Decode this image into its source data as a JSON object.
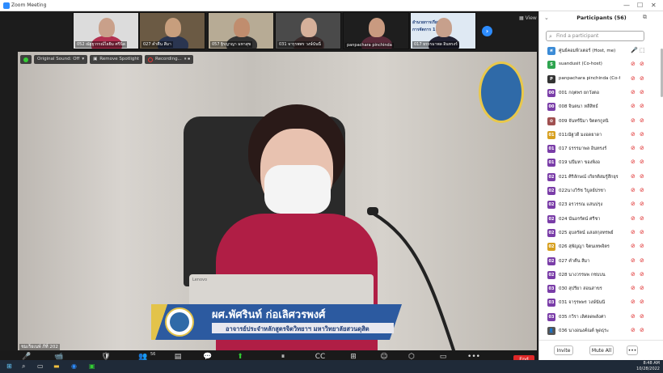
{
  "window": {
    "title": "Zoom Meeting",
    "controls": [
      "—",
      "☐",
      "✕"
    ]
  },
  "thumbnails": [
    {
      "name": "052 ณัฐฐวรรณ์ไธยิม ศรีนิล",
      "bg": "#dcdcdc",
      "skin": "#c9a08a",
      "cloth": "#b23050",
      "muted": true
    },
    {
      "name": "027 ค่ำคืน สีมา",
      "bg": "#6b5a44",
      "skin": "#c79e7d",
      "cloth": "#2a3550",
      "muted": true
    },
    {
      "name": "057 ฐิรญาญา มหาสุข",
      "bg": "#b7ab95",
      "skin": "#c08d6e",
      "cloth": "#333",
      "muted": true
    },
    {
      "name": "031 จารุรพพร วงษ์นันนี่",
      "bg": "#4a4a4a",
      "skin": "#d6b09a",
      "cloth": "#3a2a2a",
      "muted": true
    },
    {
      "name": "panpachara pinchinda",
      "bg": "#1e1e1e",
      "skin": "#c99a80",
      "cloth": "#5a2a3a",
      "muted": false
    },
    {
      "name": "017 ธรรรมาพล อินทรงร์",
      "bg": "#dfe9f3",
      "skin": "#c7a08c",
      "cloth": "#223",
      "muted": true,
      "slide_lines": [
        "อำนวยการเรียนรู้ร่วม",
        "การจัดการ 116"
      ]
    }
  ],
  "view_label": "View",
  "next_label": "›",
  "video": {
    "top_controls": [
      "Original Sound: Off",
      "Remove Spotlight",
      "Recording..."
    ],
    "speaker_name": "ผศ.พัศรินท์ ก่อเลิศวรพงศ์",
    "speaker_role": "อาจารย์ประจำหลักสูตรจิตวิทยาฯ มหาวิทยาลัยสวนดุสิต",
    "self_label": "ชมเร็ยเนพ์ ภีที่ 202",
    "laptop_brand": "Lenovo"
  },
  "toolbar": [
    {
      "label": "Mute",
      "icon": "🎤"
    },
    {
      "label": "Stop Video",
      "icon": "📹"
    },
    {
      "label": "Security",
      "icon": "🛡"
    },
    {
      "label": "Participants",
      "icon": "👥",
      "badge": "56"
    },
    {
      "label": "Polls",
      "icon": "▤"
    },
    {
      "label": "Chat",
      "icon": "💬"
    },
    {
      "label": "Share Screen",
      "icon": "⬆"
    },
    {
      "label": "Pause/Stop Recording",
      "icon": "⏸"
    },
    {
      "label": "Live Transcript",
      "icon": "CC"
    },
    {
      "label": "Breakout Rooms",
      "icon": "⊞"
    },
    {
      "label": "Reactions",
      "icon": "☺"
    },
    {
      "label": "Apps",
      "icon": "⬡"
    },
    {
      "label": "Whiteboards",
      "icon": "▭"
    },
    {
      "label": "More",
      "icon": "•••"
    }
  ],
  "end_label": "End",
  "participants": {
    "title": "Participants (56)",
    "search_placeholder": "Find a participant",
    "items": [
      {
        "initials": "ศ",
        "name": "ศูนย์คอมพิวเตอร์ (Host, me)",
        "color": "#3b8bd6",
        "mic": "🎤",
        "cam": "⬚"
      },
      {
        "initials": "S",
        "name": "suandusit (Co-host)",
        "color": "#2ea44f",
        "mic": "⊘",
        "cam": "⊘"
      },
      {
        "initials": "P",
        "name": "panpachara pinchinda (Co-host)",
        "color": "#333",
        "mic": "⊘",
        "cam": "⊘"
      },
      {
        "initials": "00",
        "name": "001 กฤตพร ยกวังตอ",
        "color": "#7a3da8",
        "mic": "⊘",
        "cam": "⊘"
      },
      {
        "initials": "00",
        "name": "008 จินตนา หลีสิทธ์",
        "color": "#7a3da8",
        "mic": "⊘",
        "cam": "⊘"
      },
      {
        "initials": "✿",
        "name": "009 จันทร์ปิมา จิตตรกูลนิ",
        "color": "#a05050",
        "mic": "⊘",
        "cam": "⊘"
      },
      {
        "initials": "01",
        "name": "011ณัฐวดี มงอดยาดา",
        "color": "#d7a020",
        "mic": "⊘",
        "cam": "⊘"
      },
      {
        "initials": "01",
        "name": "017 ธรรรมาพล อินทรงร์",
        "color": "#7a3da8",
        "mic": "⊘",
        "cam": "⊘"
      },
      {
        "initials": "01",
        "name": "019 นปีมหา ของพิ่งอ",
        "color": "#7a3da8",
        "mic": "⊘",
        "cam": "⊘"
      },
      {
        "initials": "02",
        "name": "021 ศิริลักษณ์ เกียรติสมรู้สึกยุร",
        "color": "#7a3da8",
        "mic": "⊘",
        "cam": "⊘"
      },
      {
        "initials": "02",
        "name": "022นางวิรัช วิบูลย์ปรชา",
        "color": "#7a3da8",
        "mic": "⊘",
        "cam": "⊘"
      },
      {
        "initials": "02",
        "name": "023 อรวรรณ แสนปรุง",
        "color": "#7a3da8",
        "mic": "⊘",
        "cam": "⊘"
      },
      {
        "initials": "02",
        "name": "024 นันอรรัตน์ ศรีชา",
        "color": "#7a3da8",
        "mic": "⊘",
        "cam": "⊘"
      },
      {
        "initials": "02",
        "name": "025 อุบลรัตน์ แสงสกุลทรพย์",
        "color": "#7a3da8",
        "mic": "⊘",
        "cam": "⊘"
      },
      {
        "initials": "02",
        "name": "026 สุพัญญา จิตนเทพจิตร",
        "color": "#d7a020",
        "mic": "⊘",
        "cam": "⊘"
      },
      {
        "initials": "02",
        "name": "027 ค่ำคืน สีมา",
        "color": "#7a3da8",
        "mic": "⊘",
        "cam": "⊘"
      },
      {
        "initials": "02",
        "name": "028 นางวรรษพ กชบบน",
        "color": "#7a3da8",
        "mic": "⊘",
        "cam": "⊘"
      },
      {
        "initials": "03",
        "name": "030 สุปรียา สอนสาขร",
        "color": "#7a3da8",
        "mic": "⊘",
        "cam": "⊘"
      },
      {
        "initials": "03",
        "name": "031 จารุรพพร วงษ์นันนี",
        "color": "#7a3da8",
        "mic": "⊘",
        "cam": "⊘"
      },
      {
        "initials": "03",
        "name": "035 กวีรา เลิศลดพลังศา",
        "color": "#7a3da8",
        "mic": "⊘",
        "cam": "⊘"
      },
      {
        "initials": "👤",
        "name": "036 นางอนงค์ณต์ พูดธุระ",
        "color": "#555",
        "mic": "⊘",
        "cam": "⊘"
      }
    ],
    "invite_label": "Invite",
    "mute_all_label": "Mute All",
    "more_label": "•••"
  },
  "taskbar": {
    "time": "8:48 AM",
    "date": "10/28/2022"
  }
}
